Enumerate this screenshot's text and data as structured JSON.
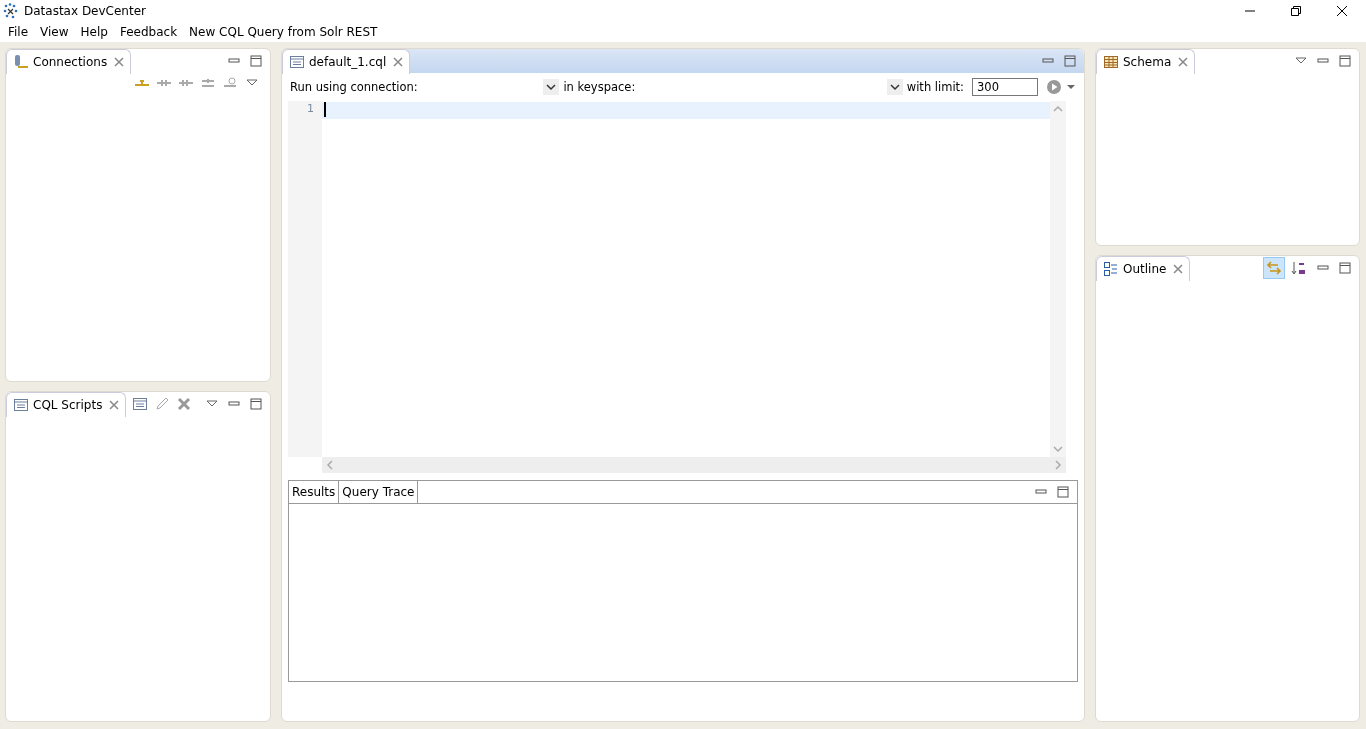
{
  "window": {
    "title": "Datastax DevCenter"
  },
  "menu": [
    "File",
    "View",
    "Help",
    "Feedback",
    "New CQL Query from Solr REST"
  ],
  "connections": {
    "tab": "Connections"
  },
  "scripts": {
    "tab": "CQL Scripts"
  },
  "editor": {
    "tab": "default_1.cql",
    "connection_label": "Run using connection:",
    "keyspace_label": "in keyspace:",
    "limit_label": "with limit:",
    "limit_value": "300",
    "line_numbers": [
      "1"
    ]
  },
  "results": {
    "tabs": [
      {
        "label": "Results"
      },
      {
        "label": "Query Trace"
      }
    ]
  },
  "schema": {
    "tab": "Schema"
  },
  "outline": {
    "tab": "Outline",
    "link_with_editor_on": true
  }
}
